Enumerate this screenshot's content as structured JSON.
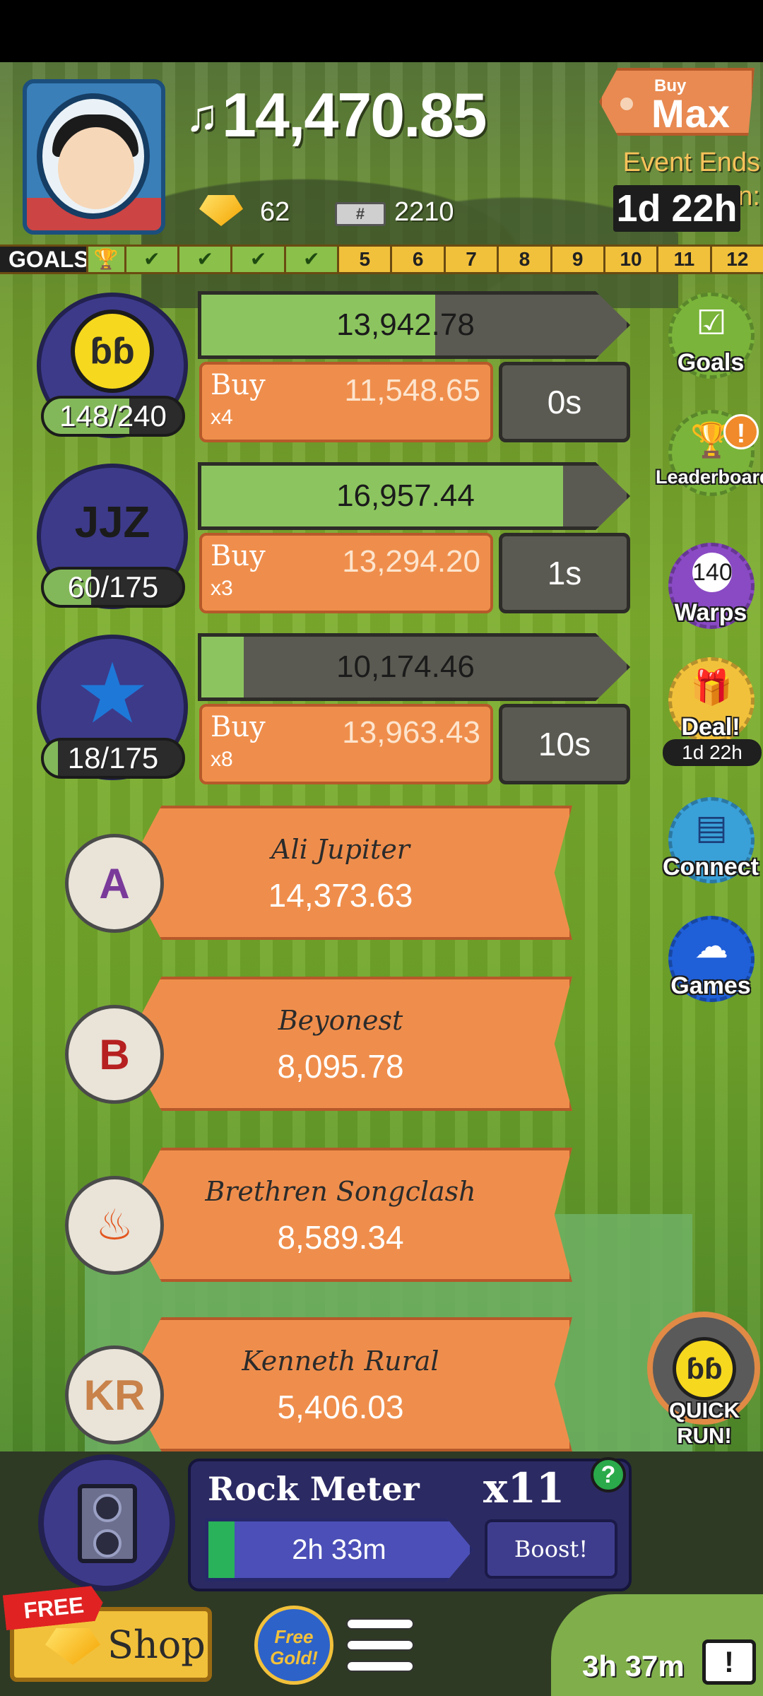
{
  "header": {
    "money": "14,470.85",
    "gold": "62",
    "tickets": "2210",
    "buy_max_small": "Buy",
    "buy_max_big": "Max",
    "event_label": "Event Ends in:",
    "event_time": "1d 22h"
  },
  "goals": {
    "label": "GOALS",
    "completed": 4,
    "steps": [
      "5",
      "6",
      "7",
      "8",
      "9",
      "10",
      "11",
      "12"
    ]
  },
  "businesses": [
    {
      "icon": "coin-icon",
      "count": "148/240",
      "count_fraction": 0.617,
      "progress_value": "13,942.78",
      "progress_fraction": 0.55,
      "buy": "Buy",
      "multiplier": "x4",
      "cost": "11,548.65",
      "time": "0s"
    },
    {
      "icon": "jjz-logo-icon",
      "count": "60/175",
      "count_fraction": 0.343,
      "progress_value": "16,957.44",
      "progress_fraction": 0.85,
      "buy": "Buy",
      "multiplier": "x3",
      "cost": "13,294.20",
      "time": "1s"
    },
    {
      "icon": "star-icon",
      "count": "18/175",
      "count_fraction": 0.103,
      "progress_value": "10,174.46",
      "progress_fraction": 0.1,
      "buy": "Buy",
      "multiplier": "x8",
      "cost": "13,963.43",
      "time": "10s"
    }
  ],
  "managers": [
    {
      "name": "Ali Jupiter",
      "value": "14,373.63",
      "initials": "A"
    },
    {
      "name": "Beyonest",
      "value": "8,095.78",
      "initials": "B"
    },
    {
      "name": "Brethren Songclash",
      "value": "8,589.34",
      "initials": "♨"
    },
    {
      "name": "Kenneth Rural",
      "value": "5,406.03",
      "initials": "KR"
    }
  ],
  "side_buttons": {
    "goals": "Goals",
    "leaderboard": "Leaderboard",
    "warps": "Warps",
    "warps_count": "140",
    "deal": "Deal!",
    "deal_time": "1d 22h",
    "connect": "Connect",
    "games": "Games",
    "alert": "!"
  },
  "quick_run": "QUICK RUN!",
  "rock_meter": {
    "title": "Rock Meter",
    "multiplier": "x11",
    "help": "?",
    "time": "2h 33m",
    "fill_fraction": 0.1,
    "boost": "Boost!"
  },
  "bottom": {
    "free_tag": "FREE",
    "shop": "Shop",
    "free_gold": "Free Gold!",
    "timer": "3h 37m",
    "tv_symbol": "!"
  },
  "colors": {
    "accent_orange": "#ef8e4c",
    "progress_green": "#8cc55f",
    "business_purple": "#3d3a8a",
    "goals_yellow": "#f2c13b"
  }
}
